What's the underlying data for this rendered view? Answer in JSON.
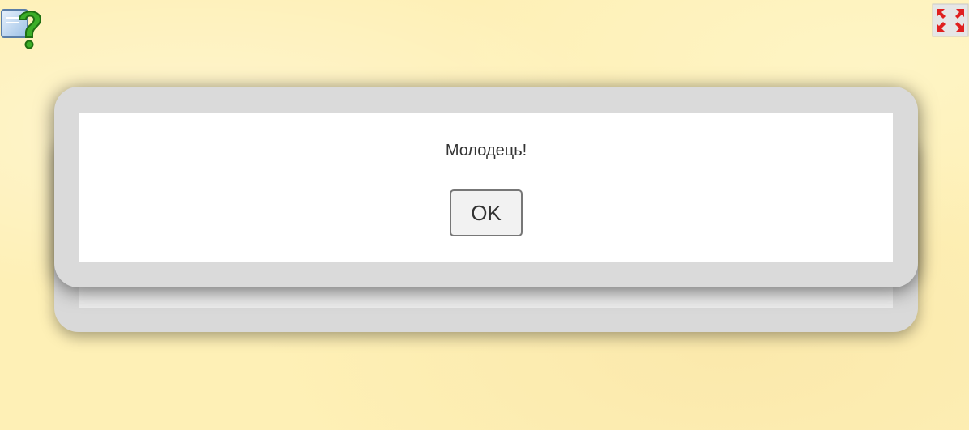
{
  "icons": {
    "help": "help-icon",
    "fullscreen": "fullscreen-icon"
  },
  "dialog": {
    "message": "Молодець!",
    "ok_label": "OK"
  },
  "colors": {
    "background": "#fef0b6",
    "dialog_frame": "#dadada",
    "dialog_body": "#ffffff",
    "help_green": "#2e9e1e",
    "fullscreen_red": "#e02020"
  }
}
